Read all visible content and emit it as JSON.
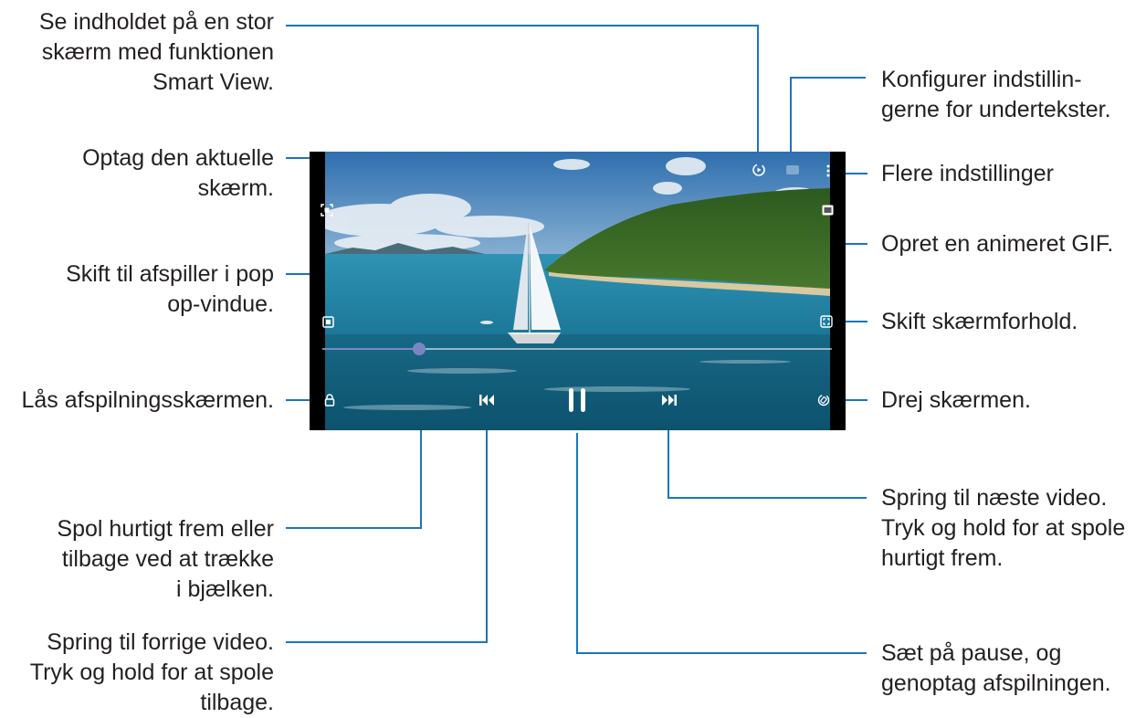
{
  "annotations": {
    "smart_view": "Se indholdet på en stor\nskærm med funktionen\nSmart View.",
    "capture": "Optag den aktuelle\nskærm.",
    "popup": "Skift til afspiller i pop\nop-vindue.",
    "lock": "Lås afspilningsskærmen.",
    "seek": "Spol hurtigt frem eller\ntilbage ved at trække\ni bjælken.",
    "previous": "Spring til forrige video.\nTryk og hold for at spole\ntilbage.",
    "subtitles": "Konfigurer indstillin-\ngerne for undertekster.",
    "more": "Flere indstillinger",
    "gif": "Opret en animeret GIF.",
    "ratio": "Skift skærmforhold.",
    "rotate": "Drej skærmen.",
    "next": "Spring til næste video.\nTryk og hold for at spole\nhurtigt frem.",
    "pause": "Sæt på pause, og\ngenoptag afspilningen."
  },
  "player": {
    "progress_fraction": 0.19,
    "icons": {
      "smart_view": "smart-view-icon",
      "subtitles": "subtitles-icon",
      "more": "more-options-icon",
      "capture": "capture-icon",
      "gif": "gif-icon",
      "popup": "popup-player-icon",
      "ratio": "aspect-ratio-icon",
      "lock": "lock-icon",
      "rotate": "rotate-icon",
      "previous": "previous-icon",
      "pause": "pause-icon",
      "next": "next-icon"
    }
  },
  "colors": {
    "callout_line": "#1b75bb",
    "seek_thumb": "#7a86c4",
    "text": "#231f20"
  }
}
